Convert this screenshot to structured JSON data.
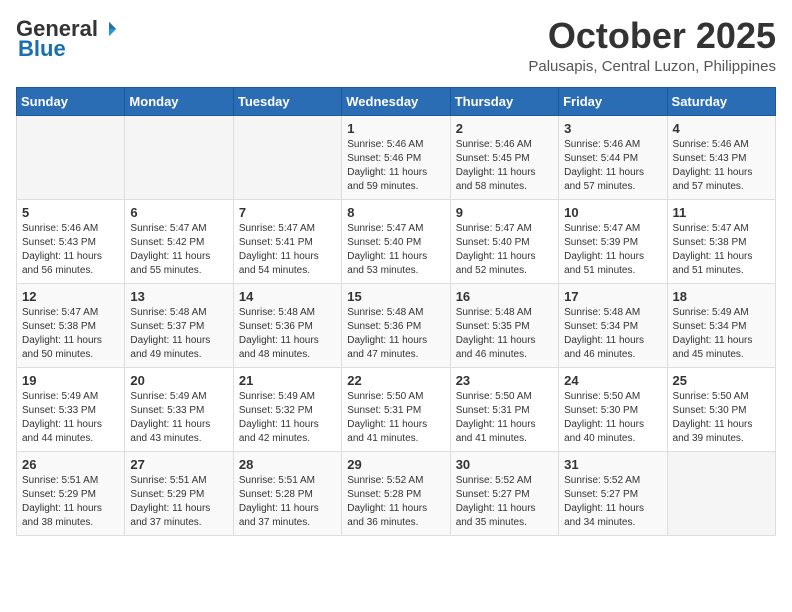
{
  "header": {
    "logo_general": "General",
    "logo_blue": "Blue",
    "month_title": "October 2025",
    "subtitle": "Palusapis, Central Luzon, Philippines"
  },
  "weekdays": [
    "Sunday",
    "Monday",
    "Tuesday",
    "Wednesday",
    "Thursday",
    "Friday",
    "Saturday"
  ],
  "weeks": [
    [
      {
        "day": "",
        "info": ""
      },
      {
        "day": "",
        "info": ""
      },
      {
        "day": "",
        "info": ""
      },
      {
        "day": "1",
        "info": "Sunrise: 5:46 AM\nSunset: 5:46 PM\nDaylight: 11 hours\nand 59 minutes."
      },
      {
        "day": "2",
        "info": "Sunrise: 5:46 AM\nSunset: 5:45 PM\nDaylight: 11 hours\nand 58 minutes."
      },
      {
        "day": "3",
        "info": "Sunrise: 5:46 AM\nSunset: 5:44 PM\nDaylight: 11 hours\nand 57 minutes."
      },
      {
        "day": "4",
        "info": "Sunrise: 5:46 AM\nSunset: 5:43 PM\nDaylight: 11 hours\nand 57 minutes."
      }
    ],
    [
      {
        "day": "5",
        "info": "Sunrise: 5:46 AM\nSunset: 5:43 PM\nDaylight: 11 hours\nand 56 minutes."
      },
      {
        "day": "6",
        "info": "Sunrise: 5:47 AM\nSunset: 5:42 PM\nDaylight: 11 hours\nand 55 minutes."
      },
      {
        "day": "7",
        "info": "Sunrise: 5:47 AM\nSunset: 5:41 PM\nDaylight: 11 hours\nand 54 minutes."
      },
      {
        "day": "8",
        "info": "Sunrise: 5:47 AM\nSunset: 5:40 PM\nDaylight: 11 hours\nand 53 minutes."
      },
      {
        "day": "9",
        "info": "Sunrise: 5:47 AM\nSunset: 5:40 PM\nDaylight: 11 hours\nand 52 minutes."
      },
      {
        "day": "10",
        "info": "Sunrise: 5:47 AM\nSunset: 5:39 PM\nDaylight: 11 hours\nand 51 minutes."
      },
      {
        "day": "11",
        "info": "Sunrise: 5:47 AM\nSunset: 5:38 PM\nDaylight: 11 hours\nand 51 minutes."
      }
    ],
    [
      {
        "day": "12",
        "info": "Sunrise: 5:47 AM\nSunset: 5:38 PM\nDaylight: 11 hours\nand 50 minutes."
      },
      {
        "day": "13",
        "info": "Sunrise: 5:48 AM\nSunset: 5:37 PM\nDaylight: 11 hours\nand 49 minutes."
      },
      {
        "day": "14",
        "info": "Sunrise: 5:48 AM\nSunset: 5:36 PM\nDaylight: 11 hours\nand 48 minutes."
      },
      {
        "day": "15",
        "info": "Sunrise: 5:48 AM\nSunset: 5:36 PM\nDaylight: 11 hours\nand 47 minutes."
      },
      {
        "day": "16",
        "info": "Sunrise: 5:48 AM\nSunset: 5:35 PM\nDaylight: 11 hours\nand 46 minutes."
      },
      {
        "day": "17",
        "info": "Sunrise: 5:48 AM\nSunset: 5:34 PM\nDaylight: 11 hours\nand 46 minutes."
      },
      {
        "day": "18",
        "info": "Sunrise: 5:49 AM\nSunset: 5:34 PM\nDaylight: 11 hours\nand 45 minutes."
      }
    ],
    [
      {
        "day": "19",
        "info": "Sunrise: 5:49 AM\nSunset: 5:33 PM\nDaylight: 11 hours\nand 44 minutes."
      },
      {
        "day": "20",
        "info": "Sunrise: 5:49 AM\nSunset: 5:33 PM\nDaylight: 11 hours\nand 43 minutes."
      },
      {
        "day": "21",
        "info": "Sunrise: 5:49 AM\nSunset: 5:32 PM\nDaylight: 11 hours\nand 42 minutes."
      },
      {
        "day": "22",
        "info": "Sunrise: 5:50 AM\nSunset: 5:31 PM\nDaylight: 11 hours\nand 41 minutes."
      },
      {
        "day": "23",
        "info": "Sunrise: 5:50 AM\nSunset: 5:31 PM\nDaylight: 11 hours\nand 41 minutes."
      },
      {
        "day": "24",
        "info": "Sunrise: 5:50 AM\nSunset: 5:30 PM\nDaylight: 11 hours\nand 40 minutes."
      },
      {
        "day": "25",
        "info": "Sunrise: 5:50 AM\nSunset: 5:30 PM\nDaylight: 11 hours\nand 39 minutes."
      }
    ],
    [
      {
        "day": "26",
        "info": "Sunrise: 5:51 AM\nSunset: 5:29 PM\nDaylight: 11 hours\nand 38 minutes."
      },
      {
        "day": "27",
        "info": "Sunrise: 5:51 AM\nSunset: 5:29 PM\nDaylight: 11 hours\nand 37 minutes."
      },
      {
        "day": "28",
        "info": "Sunrise: 5:51 AM\nSunset: 5:28 PM\nDaylight: 11 hours\nand 37 minutes."
      },
      {
        "day": "29",
        "info": "Sunrise: 5:52 AM\nSunset: 5:28 PM\nDaylight: 11 hours\nand 36 minutes."
      },
      {
        "day": "30",
        "info": "Sunrise: 5:52 AM\nSunset: 5:27 PM\nDaylight: 11 hours\nand 35 minutes."
      },
      {
        "day": "31",
        "info": "Sunrise: 5:52 AM\nSunset: 5:27 PM\nDaylight: 11 hours\nand 34 minutes."
      },
      {
        "day": "",
        "info": ""
      }
    ]
  ]
}
